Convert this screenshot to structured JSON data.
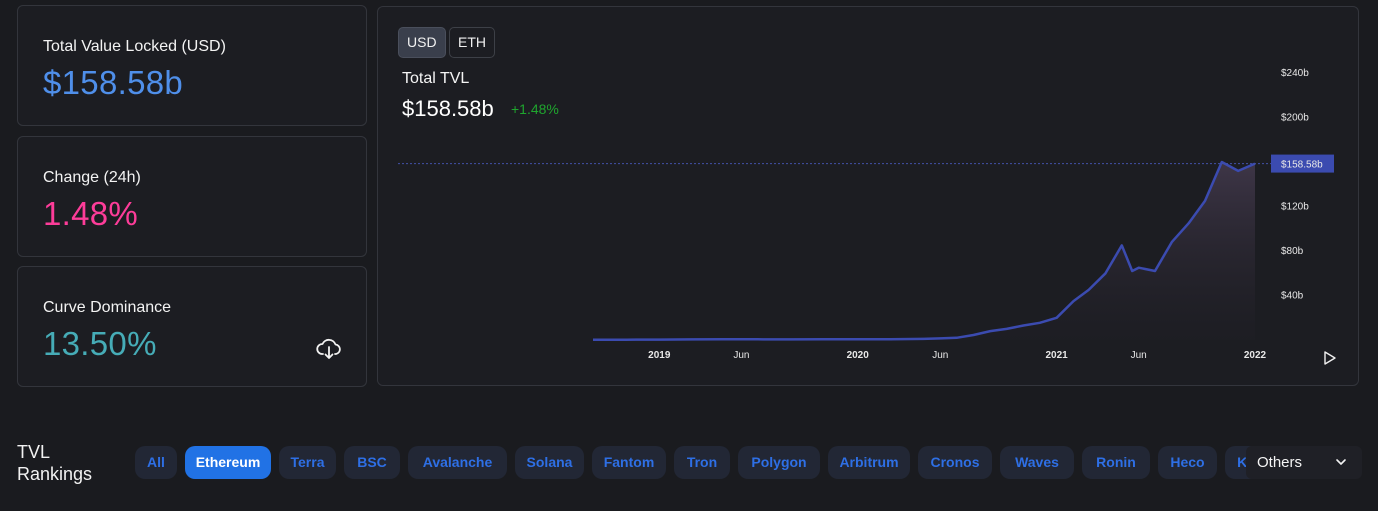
{
  "stats": [
    {
      "label": "Total Value Locked (USD)",
      "value": "$158.58b",
      "color": "#4f8fea"
    },
    {
      "label": "Change (24h)",
      "value": "1.48%",
      "color": "#fd3c99"
    },
    {
      "label": "Curve Dominance",
      "value": "13.50%",
      "color": "#46acb7"
    }
  ],
  "download_icon": "cloud-download-icon",
  "chart": {
    "currency_toggle": {
      "usd": "USD",
      "eth": "ETH",
      "active": "USD"
    },
    "title": "Total TVL",
    "value": "$158.58b",
    "change": "+1.48%",
    "current_label": "$158.58b",
    "line_color": "#3b4bb0",
    "play_icon": "play-icon"
  },
  "chart_data": {
    "type": "area",
    "title": "Total TVL",
    "x_tick_labels": [
      "2019",
      "Jun",
      "2020",
      "Jun",
      "2021",
      "Jun",
      "2022"
    ],
    "y_tick_labels": [
      "$40b",
      "$80b",
      "$120b",
      "$200b",
      "$240b"
    ],
    "ylim": [
      0,
      240
    ],
    "y_unit": "billion USD",
    "current_value": 158.58,
    "grid": false,
    "series": [
      {
        "x": [
          "2018-09",
          "2018-11",
          "2019-01",
          "2019-03",
          "2019-05",
          "2019-07",
          "2019-09",
          "2019-11",
          "2020-01",
          "2020-03",
          "2020-05",
          "2020-06",
          "2020-07",
          "2020-08",
          "2020-09",
          "2020-10",
          "2020-11",
          "2020-12",
          "2021-01",
          "2021-02",
          "2021-03",
          "2021-04",
          "2021-05",
          "2021-05-20",
          "2021-06",
          "2021-07",
          "2021-08",
          "2021-09",
          "2021-10",
          "2021-11",
          "2021-12",
          "2022-01"
        ],
        "values": [
          0.3,
          0.3,
          0.4,
          0.5,
          0.6,
          0.6,
          0.5,
          0.6,
          0.7,
          0.6,
          1.0,
          1.4,
          2.0,
          4.5,
          8.0,
          10.0,
          13.0,
          15.5,
          20.0,
          35.0,
          45.0,
          60.0,
          85.0,
          62.0,
          65.0,
          62.0,
          88.0,
          105.0,
          125.0,
          160.0,
          152.0,
          158.58
        ]
      }
    ]
  },
  "rankings": {
    "title": "TVL Rankings",
    "chains": [
      "All",
      "Ethereum",
      "Terra",
      "BSC",
      "Avalanche",
      "Solana",
      "Fantom",
      "Tron",
      "Polygon",
      "Arbitrum",
      "Cronos",
      "Waves",
      "Ronin",
      "Heco",
      "Klaytn"
    ],
    "active": "Ethereum",
    "others_label": "Others"
  }
}
